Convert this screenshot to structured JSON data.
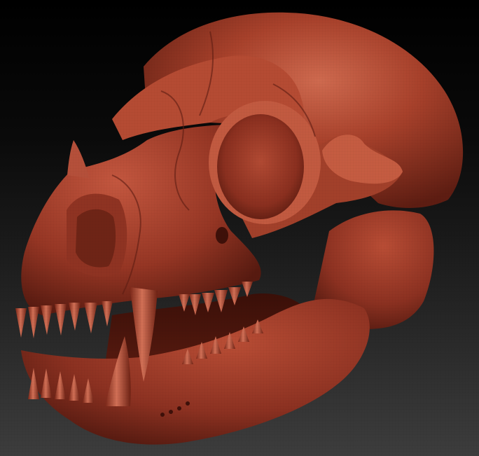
{
  "scene": {
    "subject": "skull-sculpt",
    "colors": {
      "background_top": "#000000",
      "background_bottom": "#3d3d3d",
      "clay_base": "#9a3826",
      "clay_light": "#c2553d",
      "clay_highlight": "#d67256",
      "clay_shadow": "#5a1b10",
      "clay_deep": "#3a0f08"
    }
  }
}
